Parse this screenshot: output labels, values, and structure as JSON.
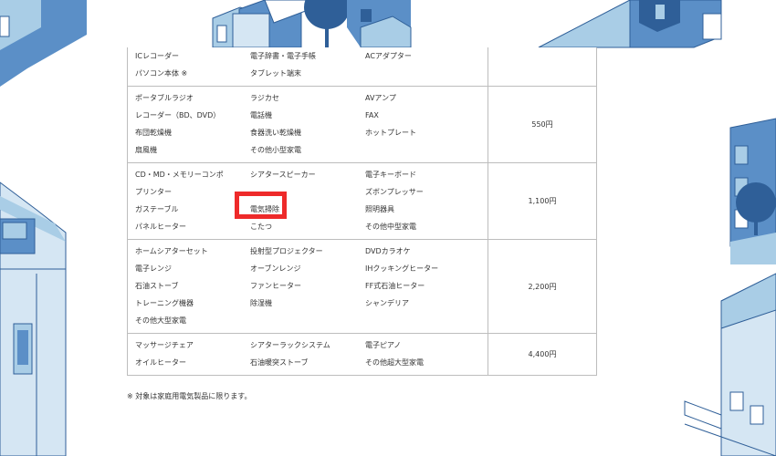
{
  "colors": {
    "illustration_blue": "#5b8fc7",
    "illustration_light": "#a9cde6",
    "illustration_dark": "#2f5f98",
    "highlight": "#ee2a2a",
    "border": "#bdbdbd"
  },
  "fee_table": {
    "rows": [
      {
        "items": [
          "ICレコーダー",
          "電子辞書・電子手帳",
          "ACアダプター",
          "パソコン本体 ※",
          "タブレット端末"
        ],
        "price": ""
      },
      {
        "items": [
          "ポータブルラジオ",
          "ラジカセ",
          "AVアンプ",
          "レコーダー（BD、DVD）",
          "電話機",
          "FAX",
          "布団乾燥機",
          "食器洗い乾燥機",
          "ホットプレート",
          "扇風機",
          "その他小型家電"
        ],
        "price": "550円"
      },
      {
        "items": [
          "CD・MD・メモリーコンポ",
          "シアタースピーカー",
          "電子キーボード",
          "プリンター",
          "",
          "ズボンプレッサー",
          "ガステーブル",
          "電気掃除",
          "照明器具",
          "パネルヒーター",
          "こたつ",
          "その他中型家電"
        ],
        "price": "1,100円"
      },
      {
        "items": [
          "ホームシアターセット",
          "投射型プロジェクター",
          "DVDカラオケ",
          "電子レンジ",
          "オーブンレンジ",
          "IHクッキングヒーター",
          "石油ストーブ",
          "ファンヒーター",
          "FF式石油ヒーター",
          "トレーニング機器",
          "除湿機",
          "シャンデリア",
          "その他大型家電"
        ],
        "price": "2,200円"
      },
      {
        "items": [
          "マッサージチェア",
          "シアターラックシステム",
          "電子ピアノ",
          "オイルヒーター",
          "石油暖突ストーブ",
          "その他超大型家電"
        ],
        "price": "4,400円"
      }
    ]
  },
  "note": "※ 対象は家庭用電気製品に限ります。"
}
